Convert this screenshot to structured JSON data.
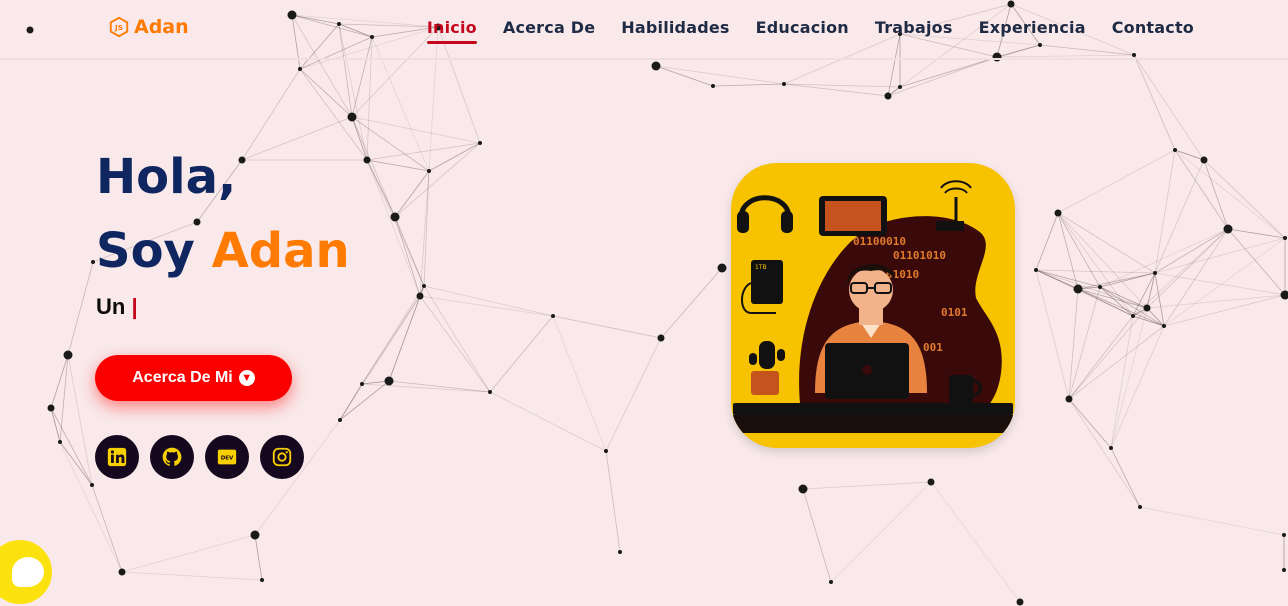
{
  "brand": {
    "name": "Adan",
    "logo_icon": "js-hexagon-icon",
    "logo_text": "JS",
    "color": "#ff7a00"
  },
  "nav": {
    "items": [
      {
        "label": "Inicio",
        "active": true
      },
      {
        "label": "Acerca De",
        "active": false
      },
      {
        "label": "Habilidades",
        "active": false
      },
      {
        "label": "Educacion",
        "active": false
      },
      {
        "label": "Trabajos",
        "active": false
      },
      {
        "label": "Experiencia",
        "active": false
      },
      {
        "label": "Contacto",
        "active": false
      }
    ],
    "active_color": "#c4071d"
  },
  "hero": {
    "line1": "Hola,",
    "line2_prefix": "Soy",
    "line2_name": "Adan",
    "typed_prefix": "Un",
    "typed_cursor": "|",
    "button_label": "Acerca De Mi",
    "button_icon": "arrow-down-circle-icon",
    "button_color": "#fb0000"
  },
  "socials": [
    {
      "name": "linkedin",
      "icon": "linkedin-icon"
    },
    {
      "name": "github",
      "icon": "github-icon"
    },
    {
      "name": "dev",
      "icon": "dev-icon",
      "text": "DEV"
    },
    {
      "name": "instagram",
      "icon": "instagram-icon"
    }
  ],
  "illustration": {
    "binary_lines": [
      "01100010",
      "01101010",
      "01010",
      "0101",
      "001"
    ],
    "storage_label": "1TB",
    "background": "#f7c300"
  },
  "chat": {
    "icon": "chat-bubble-icon",
    "color": "#fbe20e"
  },
  "colors": {
    "background": "#f9e9ea",
    "title": "#0f2660",
    "accent": "#ff7a00",
    "social_bg": "#16081e",
    "social_fg": "#f7d000"
  }
}
